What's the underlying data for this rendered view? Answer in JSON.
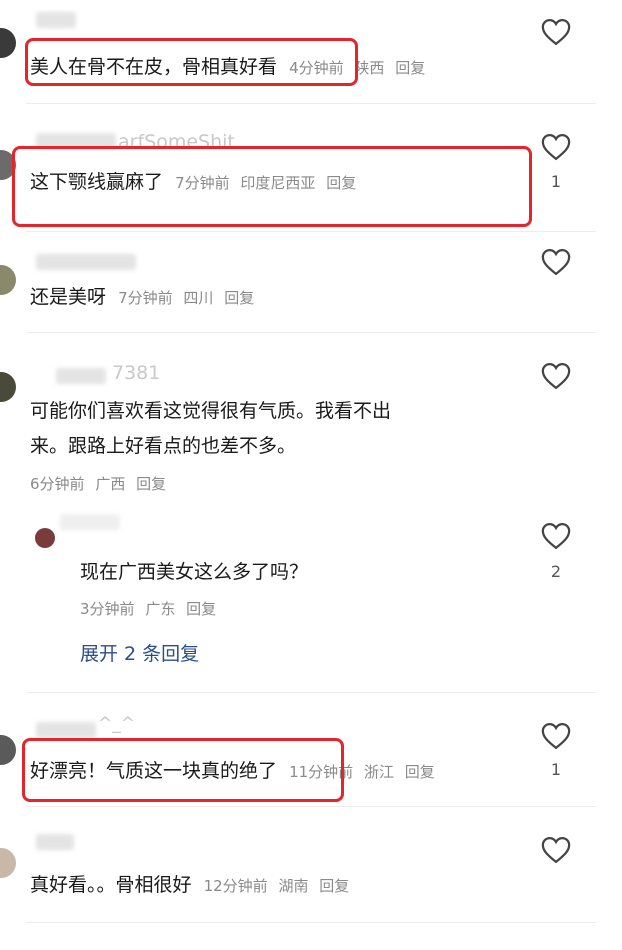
{
  "comments": [
    {
      "name": "",
      "text": "美人在骨不在皮，骨相真好看",
      "time": "4分钟前",
      "location": "陕西",
      "reply": "回复",
      "likes": ""
    },
    {
      "name": "arfSomeShit",
      "text": "这下颚线赢麻了",
      "time": "7分钟前",
      "location": "印度尼西亚",
      "reply": "回复",
      "likes": "1"
    },
    {
      "name": "",
      "text": "还是美呀",
      "time": "7分钟前",
      "location": "四川",
      "reply": "回复",
      "likes": ""
    },
    {
      "name": "7381",
      "text_line1": "可能你们喜欢看这觉得很有气质。我看不出",
      "text_line2": "来。跟路上好看点的也差不多。",
      "time": "6分钟前",
      "location": "广西",
      "reply": "回复",
      "likes": ""
    },
    {
      "name": "",
      "text": "好漂亮！气质这一块真的绝了",
      "time": "11分钟前",
      "location": "浙江",
      "reply": "回复",
      "likes": "1"
    },
    {
      "name": "",
      "text": "真好看。。骨相很好",
      "time": "12分钟前",
      "location": "湖南",
      "reply": "回复",
      "likes": ""
    }
  ],
  "sub_reply": {
    "text": "现在广西美女这么多了吗？",
    "time": "3分钟前",
    "location": "广东",
    "reply": "回复",
    "likes": "2",
    "expand": "展开 2 条回复"
  },
  "name_fragment_5": "^_^",
  "colors": {
    "highlight": "#e3262b",
    "link": "#2a4e8c"
  },
  "icons": {
    "like": "heart-outline-icon"
  }
}
